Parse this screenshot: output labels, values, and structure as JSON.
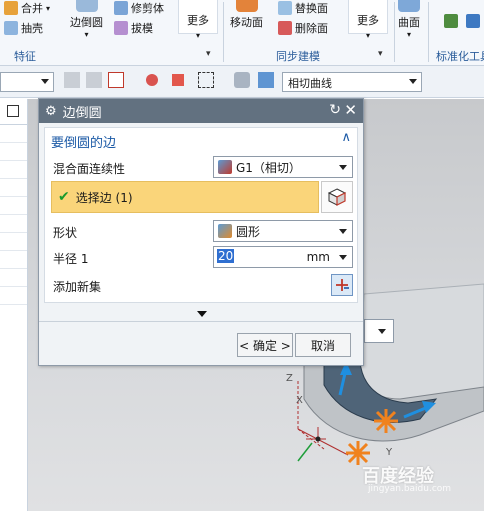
{
  "ribbon": {
    "group_feature": {
      "label": "特征",
      "items": [
        "合并",
        "抽壳",
        "边倒圆",
        "修剪体",
        "拔模"
      ],
      "more": "更多"
    },
    "group_sync": {
      "label": "同步建模",
      "items": [
        "移动面",
        "替换面",
        "删除面"
      ],
      "more": "更多"
    },
    "group_surface": {
      "item": "曲面"
    },
    "group_std": {
      "label": "标准化工具"
    }
  },
  "toolbar": {
    "filter_value": "",
    "curve_rule": "相切曲线"
  },
  "dialog": {
    "title": "边倒圆",
    "section_title": "要倒圆的边",
    "continuity_label": "混合面连续性",
    "continuity_value": "G1（相切）",
    "select_edge": "选择边 (1)",
    "shape_label": "形状",
    "shape_value": "圆形",
    "radius_label": "半径 1",
    "radius_value": "20",
    "radius_unit": "mm",
    "add_set_label": "添加新集",
    "ok": "< 确定 >",
    "cancel": "取消"
  },
  "axes": {
    "z": "Z",
    "x": "X",
    "y": "Y"
  },
  "watermark": {
    "text": "百度经验",
    "url": "jingyan.baidu.com"
  },
  "colors": {
    "title_bar": "#627180",
    "selection_highlight": "#fad57a",
    "accent_blue": "#1c5aa6"
  }
}
